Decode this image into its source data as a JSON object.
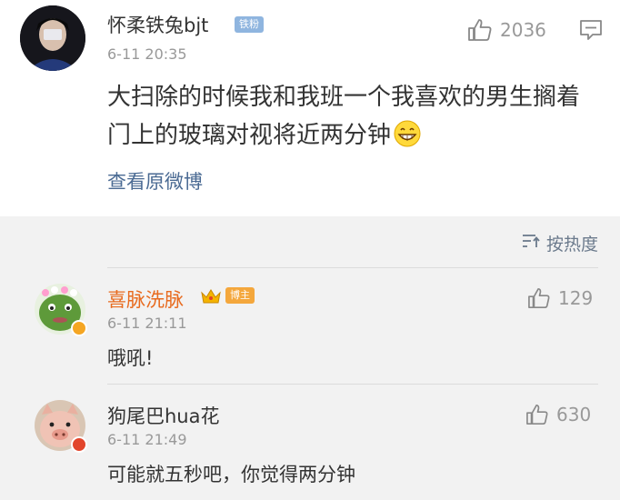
{
  "post": {
    "username": "怀柔铁兔bjt",
    "badge": "铁粉",
    "time": "6-11 20:35",
    "likes": "2036",
    "text": "大扫除的时候我和我班一个我喜欢的男生搁着门上的玻璃对视将近两分钟",
    "view_original": "查看原微博"
  },
  "comments_section": {
    "sort_label": "按热度",
    "items": [
      {
        "username": "喜脉洗脉",
        "badge": "博主",
        "time": "6-11 21:11",
        "text": "哦吼!",
        "likes": "129",
        "username_color": "#e86b1f"
      },
      {
        "username": "狗尾巴hua花",
        "time": "6-11 21:49",
        "text": "可能就五秒吧，你觉得两分钟",
        "likes": "630",
        "username_color": "#333333"
      }
    ]
  },
  "colors": {
    "link": "#4a6a93",
    "meta": "#999999",
    "section_bg": "#f2f2f2"
  }
}
